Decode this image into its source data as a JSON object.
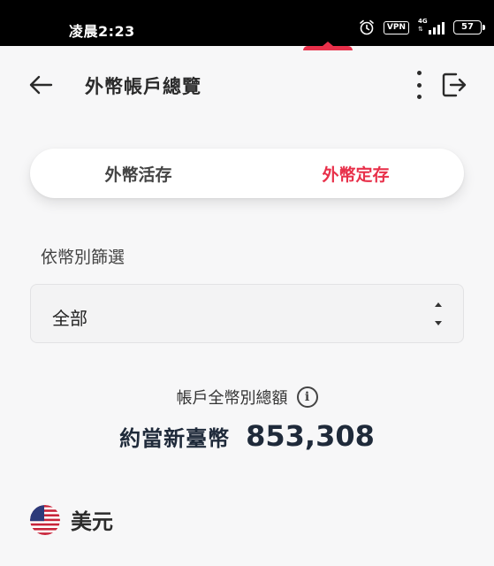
{
  "status_bar": {
    "time": "凌晨2:23",
    "vpn": "VPN",
    "network": "4G",
    "battery": "57"
  },
  "header": {
    "title": "外幣帳戶總覽",
    "icons": [
      "back-arrow-icon",
      "more-vertical-icon",
      "logout-icon"
    ]
  },
  "tabs": [
    {
      "label": "外幣活存",
      "active": false
    },
    {
      "label": "外幣定存",
      "active": true
    }
  ],
  "filter": {
    "label": "依幣別篩選",
    "selected": "全部"
  },
  "summary": {
    "label": "帳戶全幣別總額",
    "info_icon": "i",
    "prefix": "約當新臺幣",
    "amount": "853,308"
  },
  "currency": {
    "name": "美元",
    "flag": "us-flag-icon"
  },
  "colors": {
    "accent": "#e8304a",
    "text_dark": "#1f2a3a",
    "statusbar": "#000000"
  }
}
